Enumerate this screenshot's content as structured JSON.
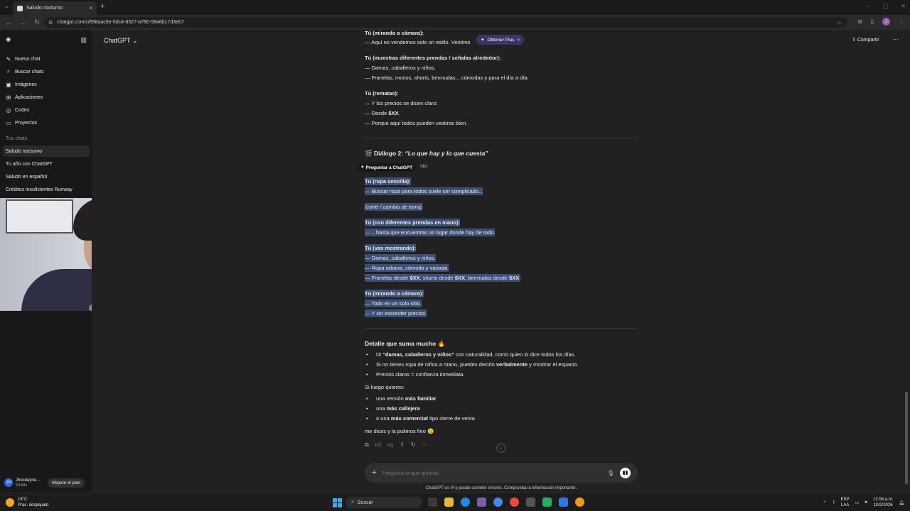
{
  "browser": {
    "tab_title": "Saludo nocturno",
    "url": "chatgpt.com/c/698aac5e-5dc4-8327-a780-58a6b17d3eb7",
    "profile_initial": "J"
  },
  "sidebar": {
    "items": [
      {
        "label": "Nuevo chat",
        "icon": "edit-icon"
      },
      {
        "label": "Buscar chats",
        "icon": "search-icon"
      },
      {
        "label": "Imágenes",
        "icon": "image-icon"
      },
      {
        "label": "Aplicaciones",
        "icon": "apps-icon"
      },
      {
        "label": "Codex",
        "icon": "codex-icon"
      },
      {
        "label": "Proyectos",
        "icon": "folder-icon"
      }
    ],
    "section_title": "Tus chats",
    "chats": [
      "Saludo nocturno",
      "Tu año con ChatGPT",
      "Saludo en español",
      "Créditos insuficientes Runway"
    ],
    "user": {
      "initials": "JH",
      "name": "Jhosdayne...",
      "plan": "Gratis"
    },
    "upgrade_label": "Mejorar el plan"
  },
  "header": {
    "model": "ChatGPT",
    "share": "Compartir",
    "plus_pill": "Obtener Plus"
  },
  "conversation": {
    "top_block": {
      "h1": "Tú (mirando a cámara):",
      "l1": "— Aquí no vendemos solo un estilo. Vestimo",
      "h2": "Tú (muestras diferentes prendas / señalas alrededor):",
      "l2": "— Damas, caballeros y niños.",
      "l3": "— Franelas, monos, shorts, bermudas... cómodas y para el día a día.",
      "h3": "Tú (rematas):",
      "l4": "— Y los precios se dicen claro:",
      "l5a": "— Desde ",
      "l5b": "$XX",
      "l5c": ".",
      "l6": "— Porque aquí todos pueden vestirse bien."
    },
    "dialog2": {
      "emoji": "🎬",
      "title_a": "Diálogo 2: ",
      "title_b": "“Lo que hay y lo que cuesta”",
      "ask_pill": "Preguntar a ChatGPT",
      "peek": "sto",
      "h1": "Tú (ropa sencilla):",
      "l1": "— Buscar ropa para todos suele ser complicado...",
      "cut": "(corte / cambio de toma)",
      "h2": "Tú (con diferentes prendas en mano):",
      "l2": "— ...hasta que encuentras un lugar donde hay de todo.",
      "h3": "Tú (vas mostrando):",
      "l3": "— Damas, caballeros y niños.",
      "l4": "— Ropa urbana, cómoda y variada.",
      "l5a": "— Franelas desde ",
      "l5b": "$XX",
      "l5c": ", shorts desde ",
      "l5d": "$XX",
      "l5e": ", bermudas desde ",
      "l5f": "$XX",
      "l5g": ".",
      "h4": "Tú (mirando a cámara):",
      "l6": "— Todo en un solo sitio.",
      "l7": "— Y sin esconder precios."
    },
    "detail": {
      "title": "Detalle que suma mucho 🔥",
      "b1a": "Di ",
      "b1b": "“damas, caballeros y niños”",
      "b1c": " con naturalidad, como quien lo dice todos los días.",
      "b2a": "Si no tienes ropa de niños a mano, puedes decirlo ",
      "b2b": "verbalmente",
      "b2c": " y mostrar el espacio.",
      "b3": "Precios claros = confianza inmediata.",
      "later": "Si luego quieres:",
      "o1a": "una versión ",
      "o1b": "más familiar",
      "o2a": "una ",
      "o2b": "más callejera",
      "o3a": "o una ",
      "o3b": "más comercial",
      "o3c": " tipo cierre de venta",
      "closing": "me dices y la pulimos fino 😉"
    }
  },
  "composer": {
    "placeholder": "Pregunta lo que quieras",
    "disclaimer": "ChatGPT es IA y puede cometer errores. Comprueba la información importante."
  },
  "taskbar": {
    "temp": "18°C",
    "weather": "Prac. despejado",
    "search": "Buscar",
    "lang1": "ESP",
    "lang2": "LAA",
    "time": "12:08 a.m.",
    "date": "10/2/2026"
  }
}
